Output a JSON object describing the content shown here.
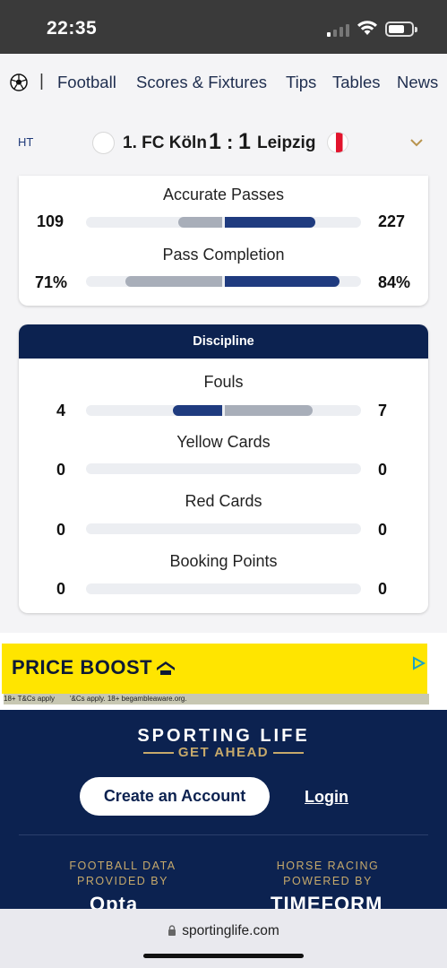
{
  "status_bar": {
    "time": "22:35"
  },
  "nav": {
    "items": [
      "Football",
      "Scores & Fixtures",
      "Tips",
      "Tables",
      "News"
    ]
  },
  "match": {
    "status": "HT",
    "home_team": "1. FC Köln",
    "home_score": "1",
    "separator": ":",
    "away_score": "1",
    "away_team": "Leipzig"
  },
  "stats_top": [
    {
      "title": "Accurate Passes",
      "home": "109",
      "away": "227",
      "home_bar_pct": 32,
      "away_bar_pct": 66,
      "home_color": "#a8aeb9",
      "away_color": "#1f3b7f"
    },
    {
      "title": "Pass Completion",
      "home": "71%",
      "away": "84%",
      "home_bar_pct": 71,
      "away_bar_pct": 84,
      "home_color": "#a8aeb9",
      "away_color": "#1f3b7f"
    }
  ],
  "discipline": {
    "header": "Discipline",
    "stats": [
      {
        "title": "Fouls",
        "home": "4",
        "away": "7",
        "home_bar_pct": 36,
        "away_bar_pct": 64,
        "home_color": "#1f3b7f",
        "away_color": "#a8aeb9"
      },
      {
        "title": "Yellow Cards",
        "home": "0",
        "away": "0",
        "home_bar_pct": 0,
        "away_bar_pct": 0
      },
      {
        "title": "Red Cards",
        "home": "0",
        "away": "0",
        "home_bar_pct": 0,
        "away_bar_pct": 0
      },
      {
        "title": "Booking Points",
        "home": "0",
        "away": "0",
        "home_bar_pct": 0,
        "away_bar_pct": 0
      }
    ]
  },
  "ad": {
    "title": "PRICE BOOST",
    "small_left": "18+ T&Cs apply",
    "small_right": "'&Cs apply. 18+ begambleaware.org."
  },
  "footer": {
    "brand": "SPORTING LIFE",
    "tagline": "GET AHEAD",
    "create_account": "Create an Account",
    "login": "Login",
    "credit_left": [
      "FOOTBALL DATA",
      "PROVIDED BY"
    ],
    "credit_left_logo": "Opta",
    "credit_right": [
      "HORSE RACING",
      "POWERED BY"
    ],
    "credit_right_logo": "TIMEFORM"
  },
  "browser": {
    "url": "sportinglife.com"
  },
  "colors": {
    "navy": "#0c2250",
    "bar_navy": "#1f3b7f",
    "bar_grey": "#a8aeb9",
    "gold": "#c6a96b",
    "ad_yellow": "#ffe500"
  }
}
